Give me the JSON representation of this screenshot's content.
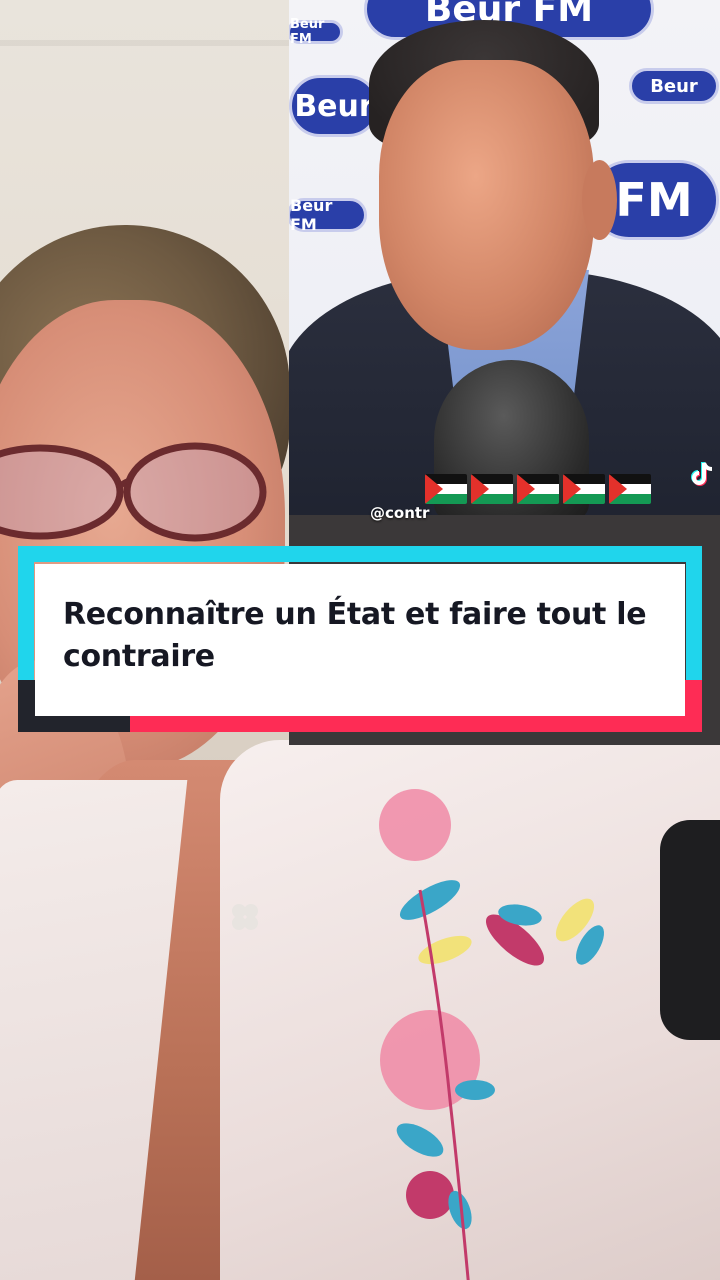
{
  "video": {
    "caption": "Reconnaître un État et faire tout le contraire",
    "inset": {
      "banner_text_large": "Beur FM",
      "banner_text_small": "Beur FM",
      "banner_text_fm": "FM",
      "banner_text_beur": "Beur",
      "flags_count": 5,
      "flag_icon": "palestine-flag-icon",
      "watermark_icon": "tiktok-logo-icon",
      "watermark_handle": "@contr"
    }
  },
  "colors": {
    "caption_cyan": "#20d5ec",
    "caption_red": "#fe2c55",
    "caption_dark": "#22242c",
    "banner_blue": "#2a3fa8"
  }
}
